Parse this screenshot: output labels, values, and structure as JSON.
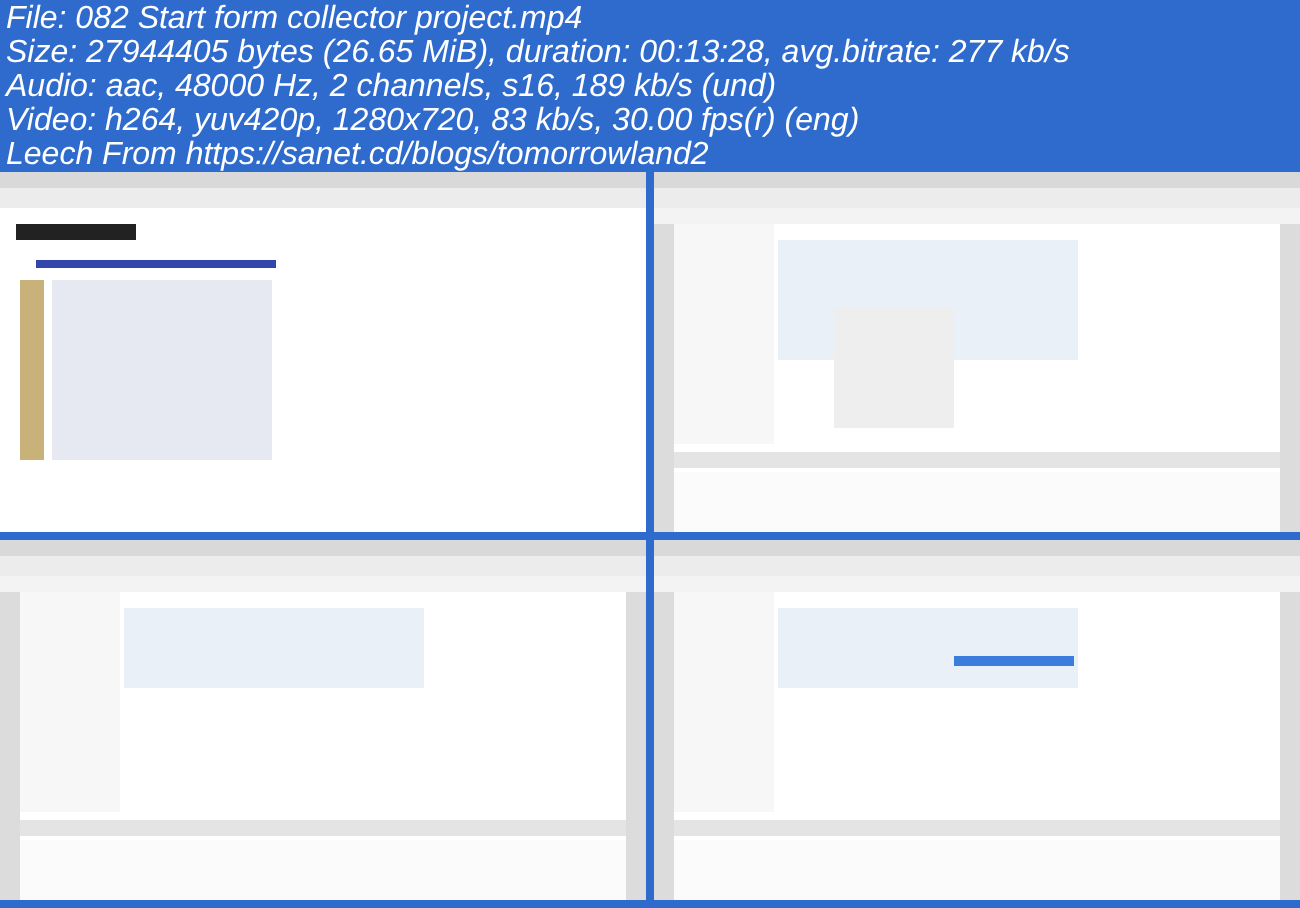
{
  "info_lines": [
    "File: 082 Start form collector project.mp4",
    "Size: 27944405 bytes (26.65 MiB), duration: 00:13:28, avg.bitrate: 277 kb/s",
    "Audio: aac, 48000 Hz, 2 channels, s16, 189 kb/s (und)",
    "Video: h264, yuv420p, 1280x720, 83 kb/s, 30.00 fps(r) (eng)",
    "Leech From https://sanet.cd/blogs/tomorrowland2"
  ]
}
